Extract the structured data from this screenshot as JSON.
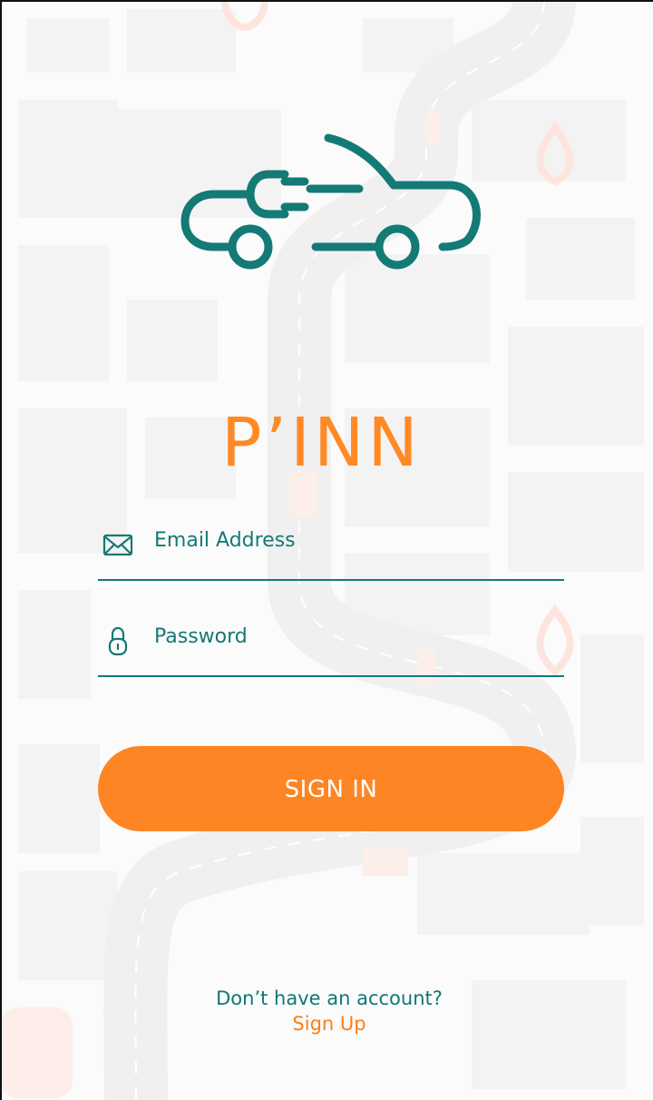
{
  "app": {
    "brand_name": "P’INN"
  },
  "form": {
    "email_label": "Email Address",
    "password_label": "Password",
    "signin_label": "SIGN IN"
  },
  "footer": {
    "prompt": "Don’t have an account?",
    "signup_label": "Sign Up"
  },
  "icons": {
    "email": "envelope-icon",
    "password": "padlock-icon",
    "logo": "plug-car-icon"
  },
  "colors": {
    "brand_teal": "#137a76",
    "brand_orange": "#fe8524",
    "background": "#fbfbfb"
  }
}
